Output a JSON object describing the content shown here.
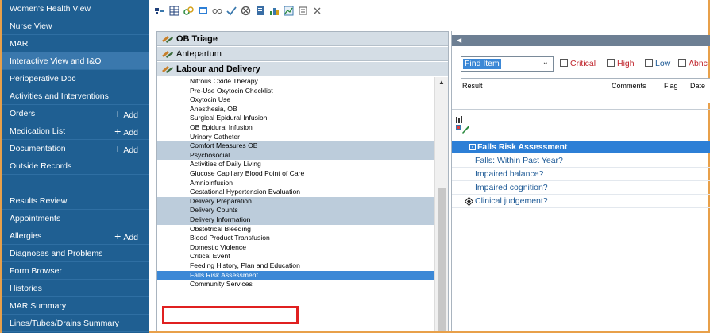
{
  "nav": {
    "items": [
      {
        "label": "Women's Health View",
        "add": ""
      },
      {
        "label": "Nurse View",
        "add": ""
      },
      {
        "label": "MAR",
        "add": ""
      },
      {
        "label": "Interactive View and I&O",
        "add": ""
      },
      {
        "label": "Perioperative Doc",
        "add": ""
      },
      {
        "label": "Activities and Interventions",
        "add": ""
      },
      {
        "label": "Orders",
        "add": "Add"
      },
      {
        "label": "Medication List",
        "add": "Add"
      },
      {
        "label": "Documentation",
        "add": "Add"
      },
      {
        "label": "Outside Records",
        "add": ""
      },
      {
        "label": "Results Review",
        "add": ""
      },
      {
        "label": "Appointments",
        "add": ""
      },
      {
        "label": "Allergies",
        "add": "Add"
      },
      {
        "label": "Diagnoses and Problems",
        "add": ""
      },
      {
        "label": "Form Browser",
        "add": ""
      },
      {
        "label": "Histories",
        "add": ""
      },
      {
        "label": "MAR Summary",
        "add": ""
      },
      {
        "label": "Lines/Tubes/Drains Summary",
        "add": ""
      }
    ],
    "selected": "Interactive View and I&O",
    "add_symbol": "+"
  },
  "toolbar": {
    "icons": [
      "band-layout-icon",
      "grid-icon",
      "link-icon",
      "table-icon",
      "glasses-icon",
      "checkmark-icon",
      "cancel-circle-icon",
      "document-icon",
      "chart-icon",
      "graph-icon",
      "note-icon",
      "close-icon"
    ]
  },
  "bands": {
    "headers": [
      "OB Triage",
      "Antepartum",
      "Labour and Delivery"
    ],
    "items": [
      {
        "label": "Nitrous Oxide Therapy",
        "state": "normal"
      },
      {
        "label": "Pre-Use Oxytocin Checklist",
        "state": "normal"
      },
      {
        "label": "Oxytocin Use",
        "state": "normal"
      },
      {
        "label": "Anesthesia, OB",
        "state": "normal"
      },
      {
        "label": "Surgical Epidural Infusion",
        "state": "normal"
      },
      {
        "label": "OB Epidural Infusion",
        "state": "normal"
      },
      {
        "label": "Urinary Catheter",
        "state": "normal"
      },
      {
        "label": "Comfort Measures OB",
        "state": "shade"
      },
      {
        "label": "Psychosocial",
        "state": "shade"
      },
      {
        "label": "Activities of Daily Living",
        "state": "normal"
      },
      {
        "label": "Glucose Capillary Blood Point of Care",
        "state": "normal"
      },
      {
        "label": "Amnioinfusion",
        "state": "normal"
      },
      {
        "label": "Gestational Hypertension Evaluation",
        "state": "normal"
      },
      {
        "label": "Delivery Preparation",
        "state": "shade"
      },
      {
        "label": "Delivery Counts",
        "state": "shade"
      },
      {
        "label": "Delivery Information",
        "state": "shade"
      },
      {
        "label": "Obstetrical Bleeding",
        "state": "normal"
      },
      {
        "label": "Blood Product Transfusion",
        "state": "normal"
      },
      {
        "label": "Domestic Violence",
        "state": "normal"
      },
      {
        "label": "Critical Event",
        "state": "normal"
      },
      {
        "label": "Feeding History, Plan and Education",
        "state": "normal"
      },
      {
        "label": "Falls Risk Assessment",
        "state": "selected"
      },
      {
        "label": "Community Services",
        "state": "normal"
      }
    ]
  },
  "right": {
    "find_item": "Find Item",
    "filters": [
      {
        "label": "Critical",
        "color": "#c0262d"
      },
      {
        "label": "High",
        "color": "#c0262d"
      },
      {
        "label": "Low",
        "color": "#1e5a96"
      },
      {
        "label": "Abnc",
        "color": "#c0262d"
      }
    ],
    "result_columns": [
      "Result",
      "Comments",
      "Flag",
      "Date"
    ],
    "section_title": "Falls Risk Assessment",
    "assessment_rows": [
      {
        "label": "Falls: Within Past Year?",
        "icon": ""
      },
      {
        "label": "Impaired balance?",
        "icon": ""
      },
      {
        "label": "Impaired cognition?",
        "icon": ""
      },
      {
        "label": "Clinical judgement?",
        "icon": "diamond-icon"
      }
    ]
  },
  "colors": {
    "nav_bg": "#1f5f92",
    "selection_blue": "#3c88d6",
    "highlight_red": "#e02020",
    "link_blue": "#1e5a96"
  }
}
